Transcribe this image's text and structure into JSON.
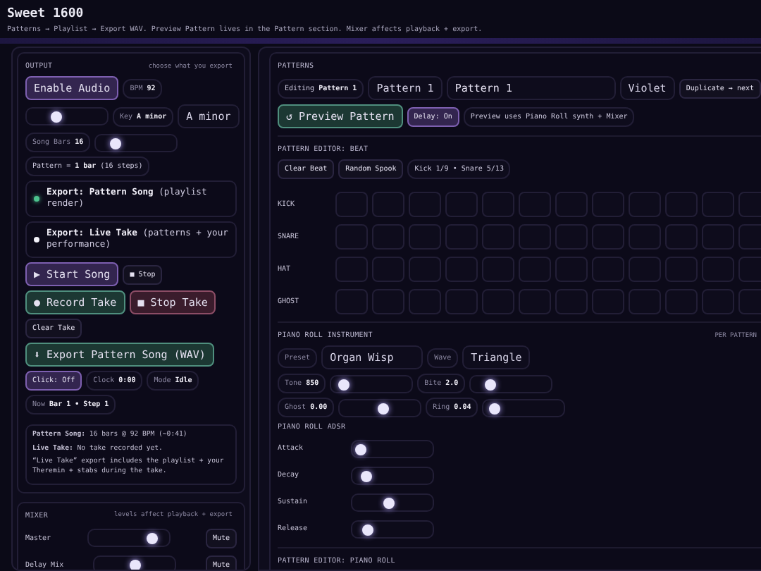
{
  "header": {
    "title": "Sweet 1600",
    "subtitle": "Patterns → Playlist → Export WAV. Preview Pattern lives in the Pattern section. Mixer affects playback + export."
  },
  "output": {
    "title": "OUTPUT",
    "hint": "choose what you export",
    "enable_button": "Enable Audio",
    "bpm_label": "BPM",
    "bpm_value": "92",
    "bpm_slider": {
      "level": 0.35
    },
    "key_label": "Key",
    "key_value": "A minor",
    "key_select": "A minor",
    "bars_label": "Song Bars",
    "bars_value": "16",
    "bars_slider": {
      "level": 0.2
    },
    "pattern_info": "Pattern = **1 bar** (16 steps)",
    "exports": [
      {
        "text": "**Export: Pattern Song** (playlist render)",
        "selected": true
      },
      {
        "text": "**Export: Live Take** (patterns + your performance)",
        "selected": false
      }
    ],
    "button_rows": [
      [
        {
          "kind": "purple",
          "label": "▶ Start Song"
        },
        {
          "kind": "chip",
          "label": "■ Stop"
        }
      ],
      [
        {
          "kind": "green",
          "label": "● Record Take"
        },
        {
          "kind": "red",
          "label": "■ Stop Take"
        }
      ],
      [
        {
          "kind": "chip",
          "label": "Clear Take"
        }
      ],
      [
        {
          "kind": "green",
          "label": "⬇ Export Pattern Song (WAV)"
        }
      ]
    ],
    "status_rows": [
      [
        {
          "kind": "purple",
          "label": "Click: Off"
        },
        {
          "kind": "info",
          "label": "Clock",
          "value": "0:00"
        },
        {
          "kind": "info",
          "label": "Mode",
          "value": "Idle"
        }
      ],
      [
        {
          "kind": "info",
          "label": "Now",
          "value": "Bar 1 • Step 1"
        }
      ]
    ],
    "info_lines": [
      "**Pattern Song:** 16 bars @ 92 BPM (~0:41)",
      "**Live Take:** No take recorded yet.",
      "“Live Take” export includes the playlist + your Theremin + stabs during the take."
    ]
  },
  "mixer": {
    "title": "MIXER",
    "hint": "levels affect playback + export",
    "channels": [
      {
        "name": "Master",
        "level": 0.85,
        "mute": "Mute"
      },
      {
        "name": "Delay Mix",
        "level": 0.5,
        "mute": "Mute"
      }
    ]
  },
  "patterns": {
    "title": "PATTERNS",
    "editing": "Editing **Pattern 1**",
    "pattern_select": "Pattern 1",
    "name_field": "Pattern 1",
    "color_select": "Violet",
    "duplicate_button": "Duplicate → next",
    "preview_button": "↺ Preview Pattern",
    "delay_button": "Delay: On",
    "preview_note": "Preview uses Piano Roll synth + Mixer"
  },
  "beat_editor": {
    "title": "PATTERN EDITOR: BEAT",
    "buttons": [
      "Clear Beat",
      "Random Spook"
    ],
    "summary": "Kick 1/9 • Snare 5/13",
    "rows": [
      {
        "name": "KICK",
        "steps": [
          false,
          false,
          false,
          false,
          false,
          false,
          false,
          false,
          false,
          false,
          false,
          false
        ]
      },
      {
        "name": "SNARE",
        "steps": [
          false,
          false,
          false,
          false,
          false,
          false,
          false,
          false,
          false,
          false,
          false,
          false
        ]
      },
      {
        "name": "HAT",
        "steps": [
          false,
          false,
          false,
          false,
          false,
          false,
          false,
          false,
          false,
          false,
          false,
          false
        ]
      },
      {
        "name": "GHOST",
        "steps": [
          false,
          false,
          false,
          false,
          false,
          false,
          false,
          false,
          false,
          false,
          false,
          false
        ]
      }
    ]
  },
  "instrument": {
    "title": "PIANO ROLL INSTRUMENT",
    "hint": "PER PATTERN",
    "preset_label": "Preset",
    "preset_value": "Organ Wisp",
    "wave_label": "Wave",
    "wave_value": "Triangle",
    "knob_rows": [
      [
        {
          "label": "Tone",
          "value": "850",
          "level": 0.1
        },
        {
          "label": "Bite",
          "value": "2.0",
          "level": 0.2
        }
      ],
      [
        {
          "label": "Ghost",
          "value": "0.00",
          "level": 0.55
        },
        {
          "label": "Ring",
          "value": "0.04",
          "level": 0.08
        }
      ]
    ]
  },
  "adsr": {
    "title": "PIANO ROLL ADSR",
    "sliders": [
      {
        "name": "Attack",
        "level": 0.05
      },
      {
        "name": "Decay",
        "level": 0.12
      },
      {
        "name": "Sustain",
        "level": 0.45
      },
      {
        "name": "Release",
        "level": 0.15
      }
    ]
  },
  "piano_roll": {
    "title": "PATTERN EDITOR: PIANO ROLL"
  }
}
